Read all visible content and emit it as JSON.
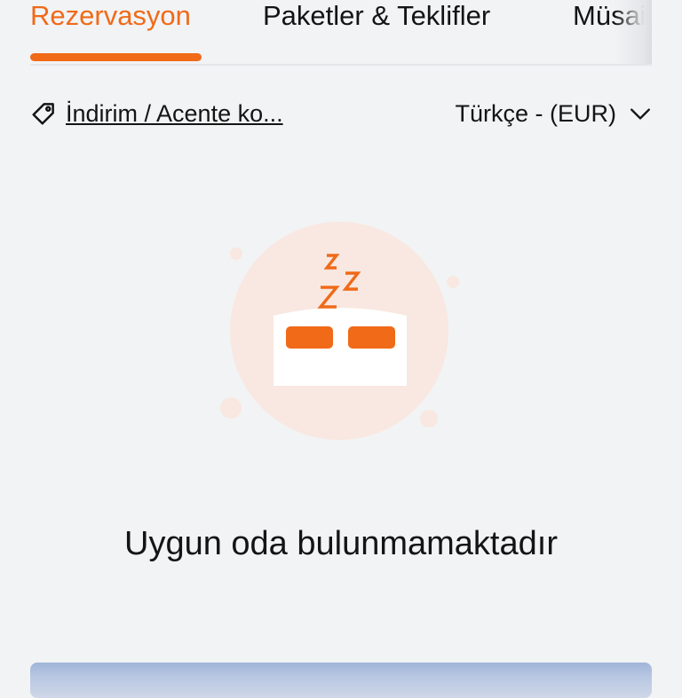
{
  "tabs": [
    {
      "label": "Rezervasyon",
      "active": true
    },
    {
      "label": "Paketler & Teklifler",
      "active": false
    },
    {
      "label": "Müsai",
      "active": false
    }
  ],
  "toolbar": {
    "promo_icon": "tag-icon",
    "promo_label": "İndirim / Acente ko...",
    "language_label": "Türkçe - (EUR)",
    "language_icon": "chevron-down-icon"
  },
  "empty_state": {
    "icon": "sleeping-bed-icon",
    "sleep_letters": [
      "Z",
      "Z",
      "Z"
    ],
    "message": "Uygun oda bulunmamaktadır"
  },
  "colors": {
    "accent": "#f06a18",
    "background": "#f2f3f5",
    "text": "#141414",
    "illustration_circle": "#f8e8e1"
  }
}
